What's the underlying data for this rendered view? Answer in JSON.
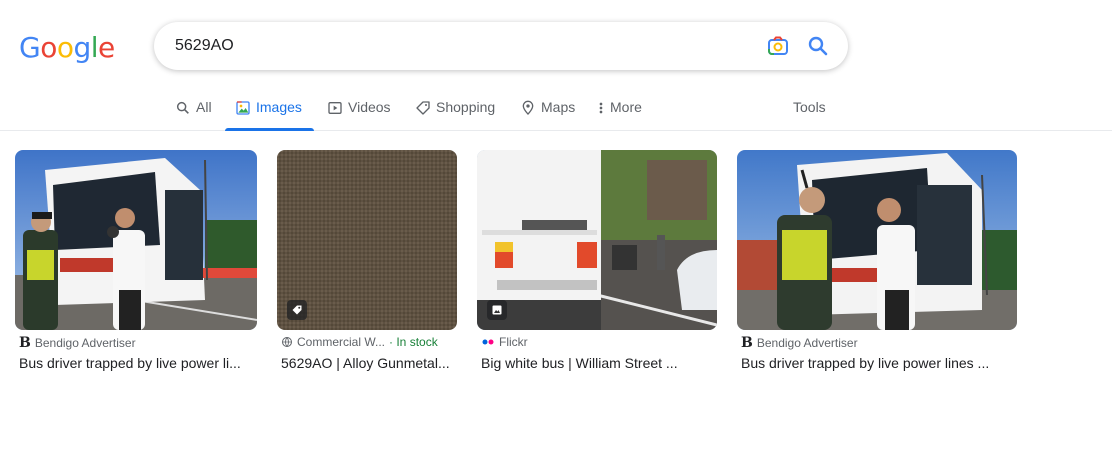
{
  "logo": {
    "letters": [
      "G",
      "o",
      "o",
      "g",
      "l",
      "e"
    ],
    "colors": [
      "#4285F4",
      "#EA4335",
      "#FBBC05",
      "#4285F4",
      "#34A853",
      "#EA4335"
    ]
  },
  "search": {
    "query": "5629AO"
  },
  "tabs": [
    {
      "label": "All",
      "icon": "search-icon"
    },
    {
      "label": "Images",
      "icon": "images-icon",
      "active": true
    },
    {
      "label": "Videos",
      "icon": "video-icon"
    },
    {
      "label": "Shopping",
      "icon": "tag-icon"
    },
    {
      "label": "Maps",
      "icon": "map-pin-icon"
    },
    {
      "label": "More",
      "icon": "more-vertical-icon"
    }
  ],
  "tools_label": "Tools",
  "accent_color": "#1a73e8",
  "results": [
    {
      "source": "Bendigo Advertiser",
      "source_icon": "B",
      "title": "Bus driver trapped by live power li..."
    },
    {
      "source": "Commercial W...",
      "stock": "· In stock",
      "title": "5629AO | Alloy Gunmetal..."
    },
    {
      "source": "Flickr",
      "title": "Big white bus | William Street ..."
    },
    {
      "source": "Bendigo Advertiser",
      "source_icon": "B",
      "title": "Bus driver trapped by live power lines ..."
    }
  ]
}
